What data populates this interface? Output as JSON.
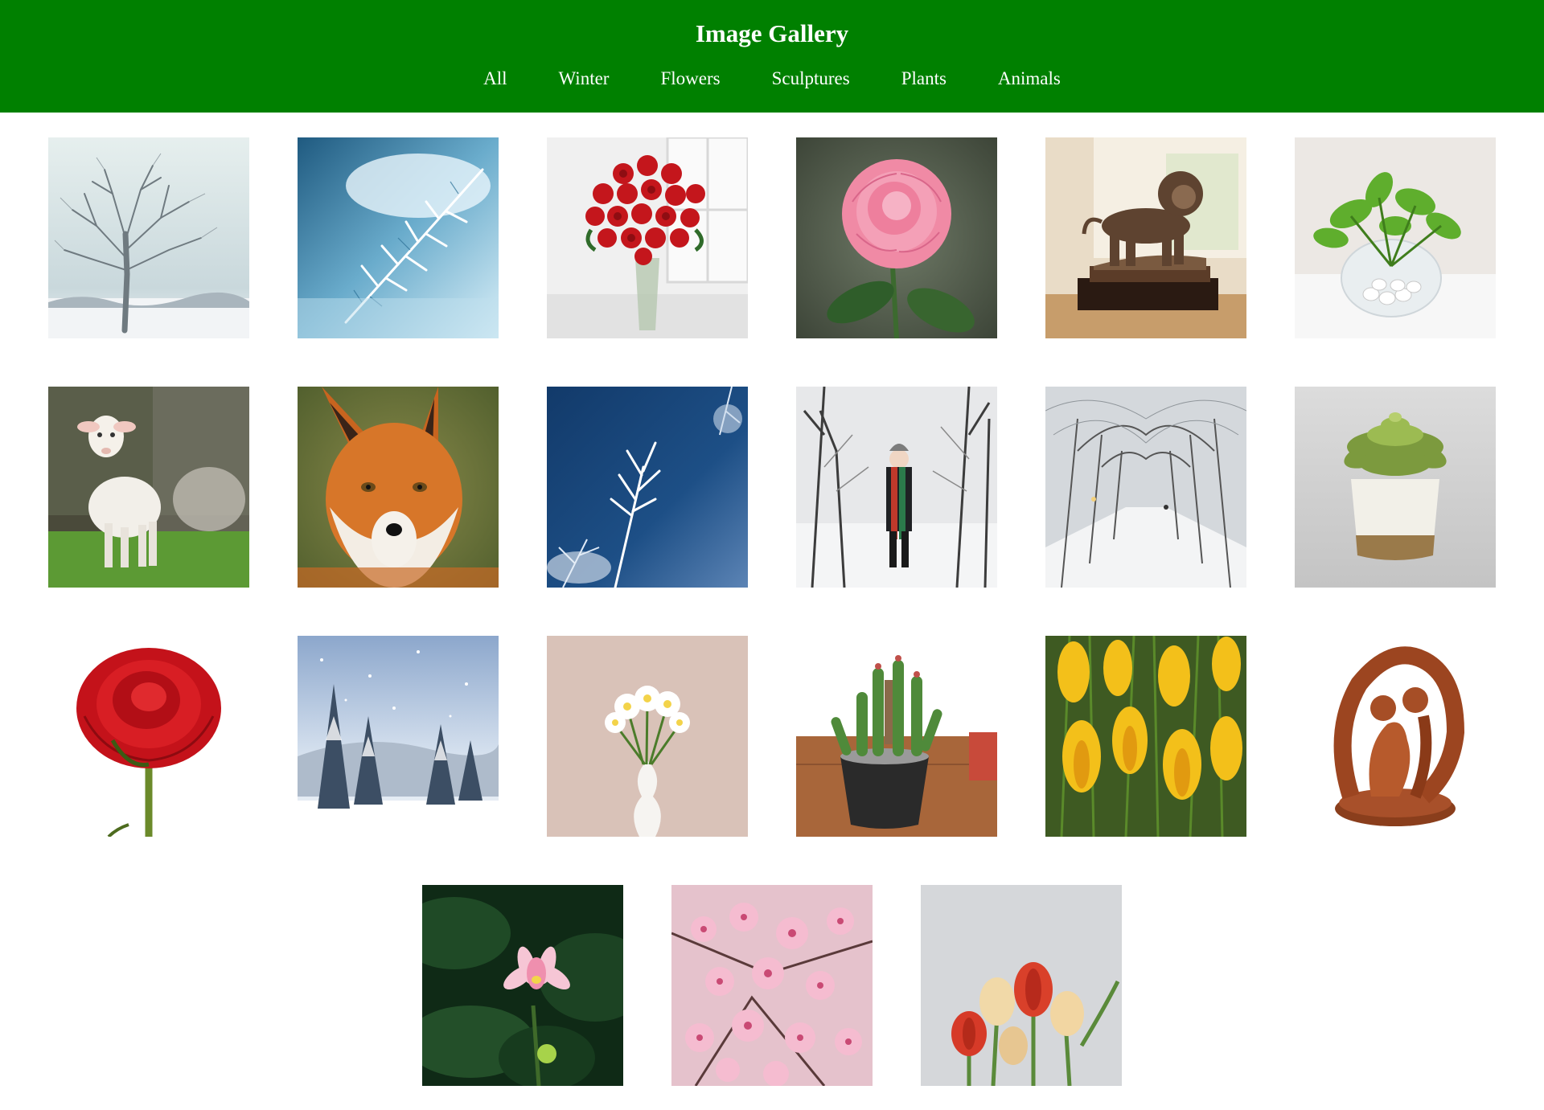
{
  "header": {
    "title": "Image Gallery",
    "background": "#008000",
    "nav": [
      {
        "label": "All"
      },
      {
        "label": "Winter"
      },
      {
        "label": "Flowers"
      },
      {
        "label": "Sculptures"
      },
      {
        "label": "Plants"
      },
      {
        "label": "Animals"
      }
    ]
  },
  "gallery": {
    "items": [
      {
        "name": "snowy-tree",
        "category": "Winter"
      },
      {
        "name": "frosted-pine-branch",
        "category": "Winter"
      },
      {
        "name": "red-roses-vase",
        "category": "Flowers"
      },
      {
        "name": "pink-rose",
        "category": "Flowers"
      },
      {
        "name": "bronze-lion-statue",
        "category": "Sculptures"
      },
      {
        "name": "pothos-glass-bowl",
        "category": "Plants"
      },
      {
        "name": "lamb",
        "category": "Animals"
      },
      {
        "name": "red-fox",
        "category": "Animals"
      },
      {
        "name": "ice-crystals",
        "category": "Winter"
      },
      {
        "name": "woman-snowy-forest",
        "category": "Winter"
      },
      {
        "name": "snowy-tree-path",
        "category": "Winter"
      },
      {
        "name": "succulent-white-pot",
        "category": "Plants"
      },
      {
        "name": "red-rose",
        "category": "Flowers"
      },
      {
        "name": "snowy-fir-forest",
        "category": "Winter"
      },
      {
        "name": "white-daffodils-vase",
        "category": "Flowers"
      },
      {
        "name": "cactus-black-pot",
        "category": "Plants"
      },
      {
        "name": "yellow-crocuses",
        "category": "Flowers"
      },
      {
        "name": "wooden-embrace-sculpture",
        "category": "Sculptures"
      },
      {
        "name": "pink-lotus",
        "category": "Flowers"
      },
      {
        "name": "cherry-blossoms",
        "category": "Flowers"
      },
      {
        "name": "tulips",
        "category": "Flowers"
      }
    ]
  }
}
